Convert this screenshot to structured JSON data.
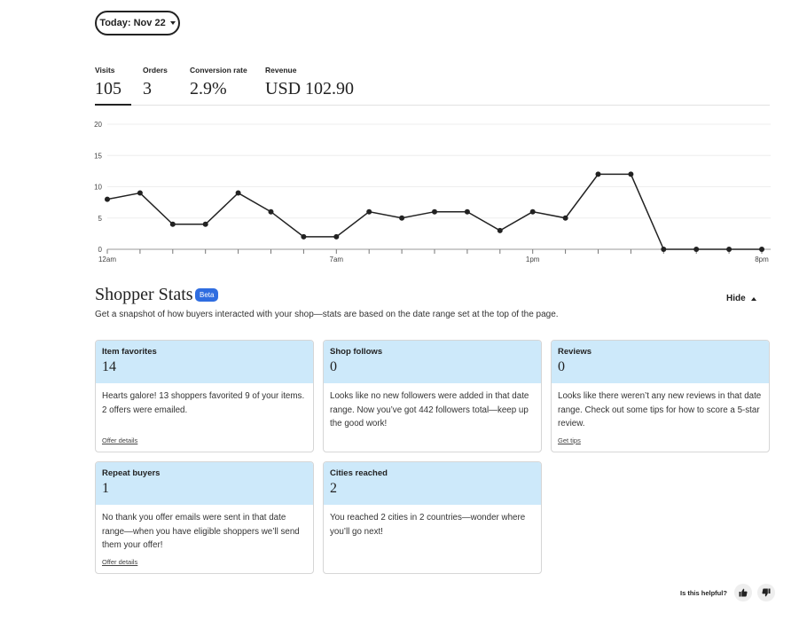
{
  "date_picker": {
    "label": "Today: Nov 22"
  },
  "metrics": [
    {
      "label": "Visits",
      "value": "105",
      "active": true
    },
    {
      "label": "Orders",
      "value": "3",
      "active": false
    },
    {
      "label": "Conversion rate",
      "value": "2.9%",
      "active": false
    },
    {
      "label": "Revenue",
      "value": "USD 102.90",
      "active": false
    }
  ],
  "chart_data": {
    "type": "line",
    "x": [
      0,
      1,
      2,
      3,
      4,
      5,
      6,
      7,
      8,
      9,
      10,
      11,
      12,
      13,
      14,
      15,
      16,
      17,
      18,
      19,
      20
    ],
    "y_ticks": [
      "0",
      "5",
      "10",
      "15",
      "20"
    ],
    "ylim": [
      0,
      20
    ],
    "x_tick_labels": [
      {
        "x": 0,
        "label": "12am"
      },
      {
        "x": 7,
        "label": "7am"
      },
      {
        "x": 13,
        "label": "1pm"
      },
      {
        "x": 20,
        "label": "8pm"
      }
    ],
    "series": [
      {
        "values": [
          8,
          9,
          4,
          4,
          9,
          6,
          2,
          2,
          6,
          5,
          6,
          6,
          3,
          6,
          5,
          12,
          12,
          0,
          0,
          0,
          0
        ]
      }
    ],
    "grid": true,
    "color": "#222222"
  },
  "shopper_stats": {
    "title": "Shopper Stats",
    "badge": "Beta",
    "subtitle": "Get a snapshot of how buyers interacted with your shop—stats are based on the date range set at the top of the page.",
    "hide_label": "Hide",
    "cards": [
      {
        "title": "Item favorites",
        "value": "14",
        "body": "Hearts galore! 13 shoppers favorited 9 of your items. 2 offers were emailed.",
        "link": "Offer details"
      },
      {
        "title": "Shop follows",
        "value": "0",
        "body": "Looks like no new followers were added in that date range. Now you’ve got 442 followers total—keep up the good work!",
        "link": ""
      },
      {
        "title": "Reviews",
        "value": "0",
        "body": "Looks like there weren’t any new reviews in that date range. Check out some tips for how to score a 5-star review.",
        "link": "Get tips"
      },
      {
        "title": "Repeat buyers",
        "value": "1",
        "body": "No thank you offer emails were sent in that date range—when you have eligible shoppers we’ll send them your offer!",
        "link": "Offer details"
      },
      {
        "title": "Cities reached",
        "value": "2",
        "body": "You reached 2 cities in 2 countries—wonder where you’ll go next!",
        "link": ""
      }
    ]
  },
  "feedback": {
    "label": "Is this helpful?",
    "up_icon": "thumbs-up-icon",
    "down_icon": "thumbs-down-icon"
  }
}
